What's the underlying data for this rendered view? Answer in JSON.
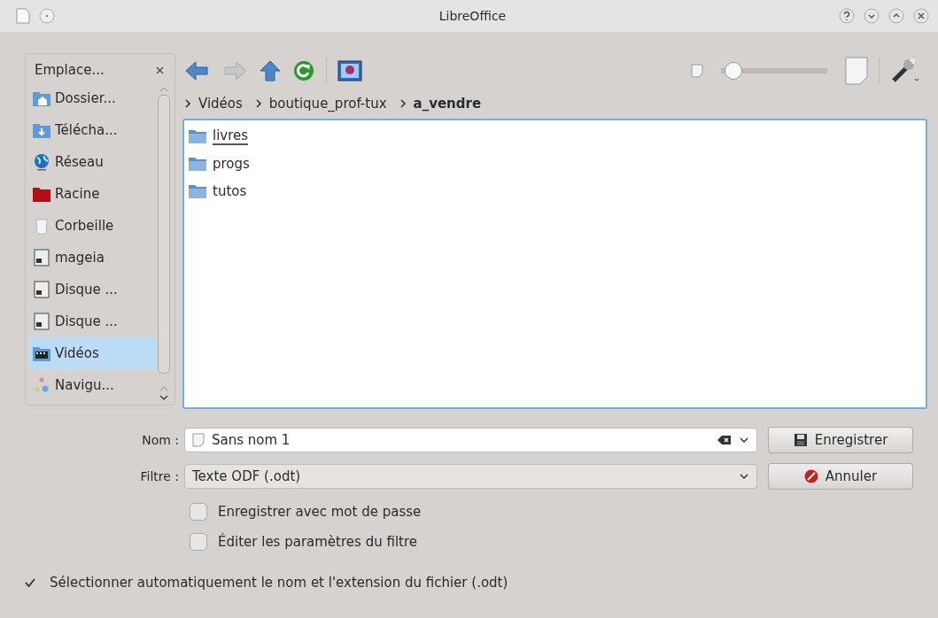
{
  "window": {
    "title": "LibreOffice"
  },
  "sidebar": {
    "title": "Emplace...",
    "items": [
      {
        "label": "Dossier...",
        "kind": "home",
        "selected": false
      },
      {
        "label": "Télécha...",
        "kind": "download",
        "selected": false
      },
      {
        "label": "Réseau",
        "kind": "network",
        "selected": false
      },
      {
        "label": "Racine",
        "kind": "root",
        "selected": false
      },
      {
        "label": "Corbeille",
        "kind": "trash",
        "selected": false
      },
      {
        "label": "mageia",
        "kind": "disk",
        "selected": false
      },
      {
        "label": "Disque ...",
        "kind": "disk",
        "selected": false
      },
      {
        "label": "Disque ...",
        "kind": "disk",
        "selected": false
      },
      {
        "label": "Vidéos",
        "kind": "videos",
        "selected": true
      },
      {
        "label": "Navigu...",
        "kind": "navigate",
        "selected": false
      }
    ]
  },
  "toolbar": {
    "zoom": {
      "level": 0.05
    }
  },
  "breadcrumb": [
    {
      "label": "Vidéos",
      "current": false
    },
    {
      "label": "boutique_prof-tux",
      "current": false
    },
    {
      "label": "a_vendre",
      "current": true
    }
  ],
  "files": [
    {
      "name": "livres",
      "selected": true
    },
    {
      "name": "progs",
      "selected": false
    },
    {
      "name": "tutos",
      "selected": false
    }
  ],
  "name_field": {
    "label": "Nom :",
    "value": "Sans nom 1"
  },
  "filter_field": {
    "label": "Filtre :",
    "value": "Texte ODF (.odt)"
  },
  "buttons": [
    {
      "label": "Enregistrer",
      "kind": "save"
    },
    {
      "label": "Annuler",
      "kind": "cancel"
    }
  ],
  "options": [
    {
      "label": "Enregistrer avec mot de passe",
      "checked": false
    },
    {
      "label": "Éditer les paramètres du filtre",
      "checked": false
    }
  ],
  "auto_extension": {
    "label": "Sélectionner automatiquement le nom et l'extension du fichier (.odt)",
    "checked": true
  }
}
